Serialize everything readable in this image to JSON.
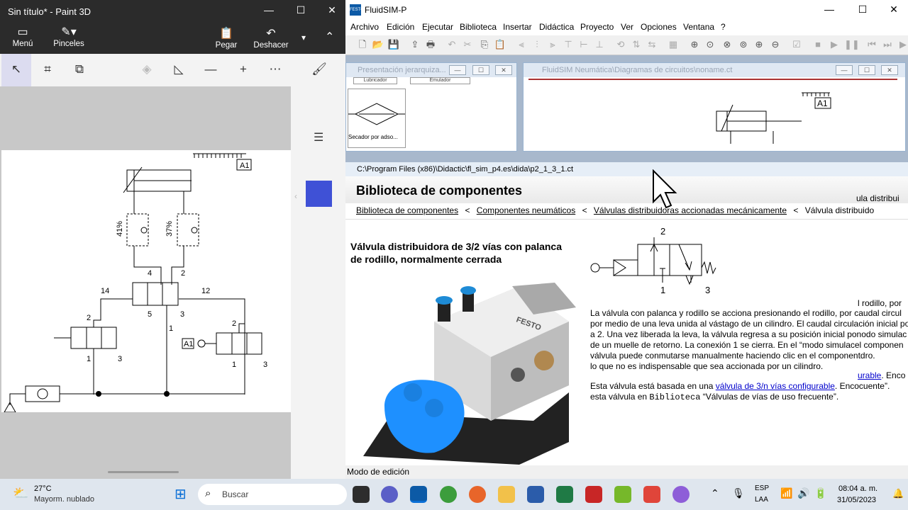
{
  "paint3d": {
    "title": "Sin título* - Paint 3D",
    "window_controls": [
      "—",
      "☐",
      "✕"
    ],
    "ribbon": {
      "menu": "Menú",
      "brushes": "Pinceles",
      "paste": "Pegar",
      "undo": "Deshacer"
    },
    "diagram": {
      "label_a1": "A1",
      "pct_left": "41%",
      "pct_right": "37%",
      "port_4": "4",
      "port_2": "2",
      "port_14": "14",
      "port_12": "12",
      "port_5": "5",
      "port_3": "3",
      "port_1": "1",
      "left_valve_2": "2",
      "left_valve_1": "1",
      "left_valve_3": "3",
      "right_valve_2": "2",
      "right_valve_1": "1",
      "right_valve_3": "3",
      "right_a1": "A1"
    },
    "color_swatch": "#3f51d6"
  },
  "fluidsim": {
    "title": "FluidSIM-P",
    "window_controls": [
      "—",
      "☐",
      "✕"
    ],
    "menus": [
      "Archivo",
      "Edición",
      "Ejecutar",
      "Biblioteca",
      "Insertar",
      "Didáctica",
      "Proyecto",
      "Ver",
      "Opciones",
      "Ventana",
      "?"
    ],
    "child1": {
      "title": "Presentación jerarquiza...",
      "labels": [
        "Lubricador",
        "Emulador",
        "Secador por adso..."
      ]
    },
    "child2": {
      "title": "FluidSIM Neumática\\Diagramas de circuitos\\noname.ct",
      "label_a1": "A1"
    },
    "help": {
      "path": "C:\\Program Files (x86)\\Didactic\\fl_sim_p4.es\\dida\\p2_1_3_1.ct",
      "heading": "Biblioteca de componentes",
      "crumb1": "Biblioteca de componentes",
      "crumb2": "Componentes neumáticos",
      "crumb3": "Válvulas distribuidoras accionadas mecánicamente",
      "crumb4": "Válvula distribuido",
      "right_overflow": "ula distribui",
      "sep": "<",
      "subtitle_line1": "Válvula distribuidora de 3/2 vías con palanca",
      "subtitle_line2": "de rodillo, normalmente cerrada",
      "sym_2": "2",
      "sym_1": "1",
      "sym_3": "3",
      "stray": "l rodillo, por",
      "para1": [
        "La válvula con palanca y rodillo se acciona presionando el rodillo, por caudal circul",
        "por medio de una leva unida al vástago de un cilindro. El caudal circulación inicial po",
        "a 2. Una vez liberada la leva, la válvula regresa a su posición inicial ponodo simulac",
        "de un muelle de retorno. La conexión 1 se cierra. En el “modo simulacel componen",
        "válvula puede conmutarse manualmente haciendo clic en el componentdro.",
        "lo que no es indispensable que sea accionada por un cilindro."
      ],
      "link_tail": "urable",
      "link_tail2": ". Enco",
      "para2_pre": "Esta válvula está basada en una ",
      "para2_link": "válvula de 3/n vías configurable",
      "para2_post": ". Encocuente”.",
      "para3_pre": "esta válvula en ",
      "para3_mono": "Biblioteca",
      "para3_post": " “Válvulas de vías de uso frecuente”.",
      "photo_brand": "FESTO"
    },
    "status": "Modo de edición"
  },
  "taskbar": {
    "weather_temp": "27°C",
    "weather_desc": "Mayorm. nublado",
    "search": "Buscar",
    "lang1": "ESP",
    "lang2": "LAA",
    "time": "08:04 a. m.",
    "date": "31/05/2023"
  }
}
